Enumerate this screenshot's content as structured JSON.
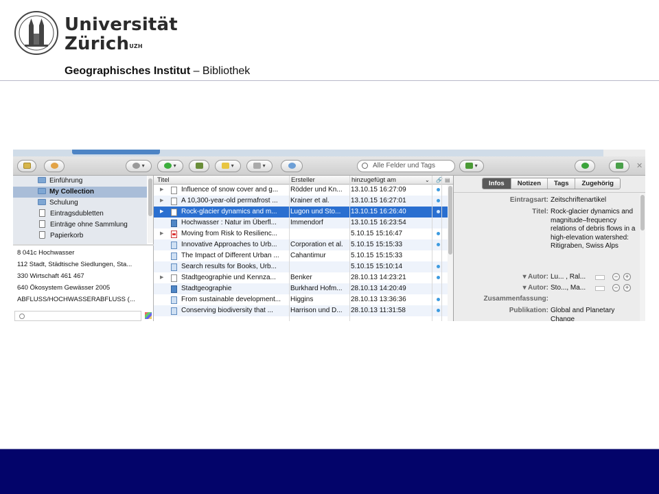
{
  "header": {
    "university_line1": "Universität",
    "university_line2": "Zürich",
    "university_sup": "UZH",
    "institute_bold": "Geographisches Institut",
    "institute_rest": " – Bibliothek"
  },
  "app": {
    "search_placeholder": "Alle Felder und Tags",
    "collections": [
      {
        "label": "Einführung",
        "icon": "folder-icon"
      },
      {
        "label": "My Collection",
        "icon": "folder-icon",
        "selected": true
      },
      {
        "label": "Schulung",
        "icon": "folder-icon"
      },
      {
        "label": "Eintragsdubletten",
        "icon": "duplicate-icon"
      },
      {
        "label": "Einträge ohne Sammlung",
        "icon": "document-icon"
      },
      {
        "label": "Papierkorb",
        "icon": "trash-icon"
      }
    ],
    "tags": [
      "8   041c Hochwasser",
      "112 Stadt, Städtische Siedlungen, Sta...",
      "330 Wirtschaft    461    467",
      "640 Ökosystem Gewässer    2005",
      "ABFLUSS/HOCHWASSERABFLUSS (..."
    ],
    "columns": {
      "title": "Titel",
      "creator": "Ersteller",
      "added": "hinzugefügt am"
    },
    "items": [
      {
        "title": "Influence of snow cover and g...",
        "creator": "Rödder und Kn...",
        "added": "13.10.15 16:27:09",
        "icon": "document",
        "dot": true
      },
      {
        "title": "A 10,300-year-old permafrost ...",
        "creator": "Krainer et al.",
        "added": "13.10.15 16:27:01",
        "icon": "document",
        "dot": true
      },
      {
        "title": "Rock-glacier dynamics and m...",
        "creator": "Lugon und Sto...",
        "added": "13.10.15 16:26:40",
        "icon": "document",
        "dot": true,
        "selected": true
      },
      {
        "title": "Hochwasser : Natur im Überfl...",
        "creator": "Immendorf",
        "added": "13.10.15 16:23:54",
        "icon": "book",
        "dot": false
      },
      {
        "title": "Moving from Risk to Resilienc...",
        "creator": "",
        "added": "5.10.15 15:16:47",
        "icon": "pdf",
        "dot": true
      },
      {
        "title": "Innovative Approaches to Urb...",
        "creator": "Corporation et al.",
        "added": "5.10.15 15:15:33",
        "icon": "web",
        "dot": true
      },
      {
        "title": "The Impact of Different Urban ...",
        "creator": "Cahantimur",
        "added": "5.10.15 15:15:33",
        "icon": "web",
        "dot": false
      },
      {
        "title": "Search results for Books, Urb...",
        "creator": "",
        "added": "5.10.15 15:10:14",
        "icon": "web",
        "dot": true
      },
      {
        "title": "Stadtgeographie und Kennza...",
        "creator": "Benker",
        "added": "28.10.13 14:23:21",
        "icon": "document",
        "dot": true
      },
      {
        "title": "Stadtgeographie",
        "creator": "Burkhard Hofm...",
        "added": "28.10.13 14:20:49",
        "icon": "book",
        "dot": false
      },
      {
        "title": "From sustainable development...",
        "creator": "Higgins",
        "added": "28.10.13 13:36:36",
        "icon": "web",
        "dot": true
      },
      {
        "title": "Conserving biodiversity that ...",
        "creator": "Harrison und D...",
        "added": "28.10.13 11:31:58",
        "icon": "web",
        "dot": true
      }
    ],
    "tabs": [
      "Infos",
      "Notizen",
      "Tags",
      "Zugehörig"
    ],
    "info": {
      "type_label": "Eintragsart:",
      "type_value": "Zeitschriftenartikel",
      "title_label": "Titel:",
      "title_value": "Rock-glacier dynamics and magnitude–frequency relations of debris flows in a high-elevation watershed: Ritigraben, Swiss Alps",
      "author1_label": "▾ Autor:",
      "author1_value": "Lu...  ,  Ral...",
      "author2_label": "▾ Autor:",
      "author2_value": "Sto...,  Ma...",
      "abstract_label": "Zusammenfassung:",
      "publication_label": "Publikation:",
      "publication_value": "Global and Planetary Change"
    },
    "accent_color": "#2a6fd0"
  },
  "footer": {
    "color": "#03046a"
  }
}
